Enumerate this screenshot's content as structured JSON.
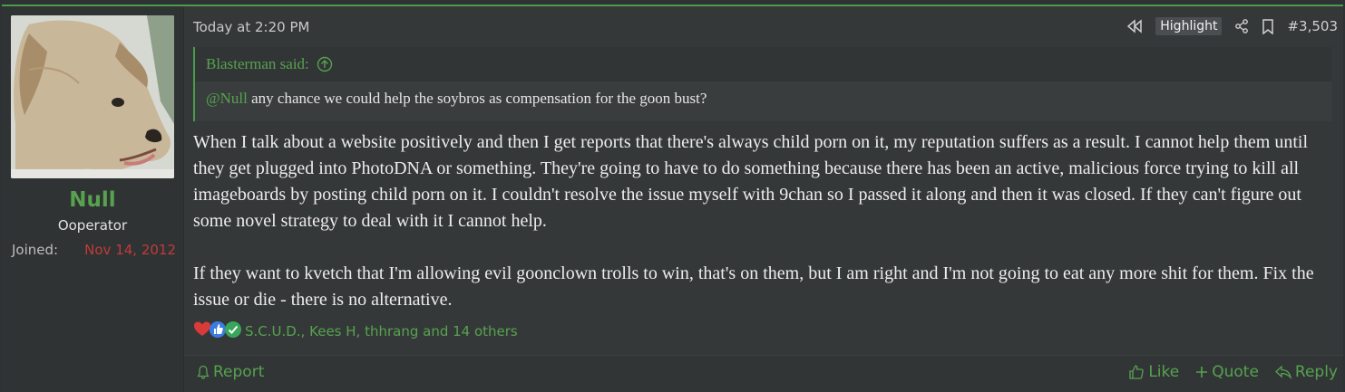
{
  "user": {
    "name": "Null",
    "title": "Ooperator",
    "joined_label": "Joined:",
    "joined_date": "Nov 14, 2012"
  },
  "post": {
    "time": "Today at 2:20 PM",
    "highlight_label": "Highlight",
    "number": "#3,503"
  },
  "quote": {
    "author_line": "Blasterman said:",
    "mention": "@Null",
    "text": " any chance we could help the soybros as compensation for the goon bust?"
  },
  "message": {
    "p1": "When I talk about a website positively and then I get reports that there's always child porn on it, my reputation suffers as a result. I cannot help them until they get plugged into PhotoDNA or something. They're going to have to do something because there has been an active, malicious force trying to kill all imageboards by posting child porn on it. I couldn't resolve the issue myself with 9chan so I passed it along and then it was closed. If they can't figure out some novel strategy to deal with it I cannot help.",
    "p2": "If they want to kvetch that I'm allowing evil goonclown trolls to win, that's on them, but I am right and I'm not going to eat any more shit for them. Fix the issue or die - there is no alternative."
  },
  "reactions": {
    "icons": [
      "heart-icon",
      "thumbs-up-icon",
      "check-icon"
    ],
    "names": "S.C.U.D., Kees H, thhrang and 14 others"
  },
  "footer": {
    "report": "Report",
    "like": "Like",
    "quote": "Quote",
    "reply": "Reply"
  },
  "colors": {
    "accent": "#56a24f",
    "date_red": "#c23a3a",
    "background": "#353839"
  }
}
